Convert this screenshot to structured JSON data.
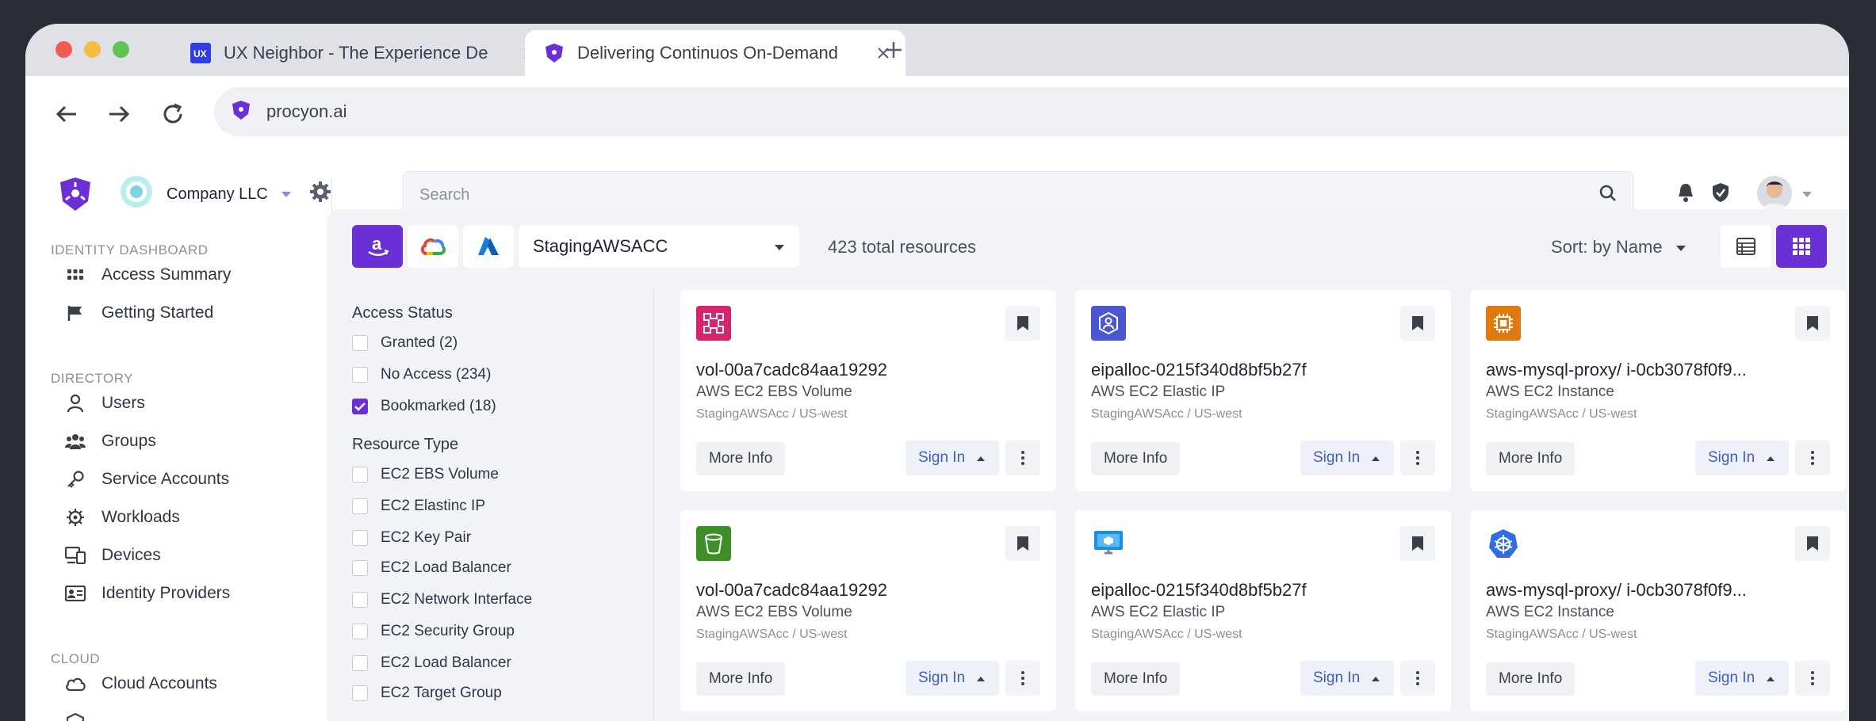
{
  "browser": {
    "tabs": [
      {
        "title": "UX Neighbor - The Experience De",
        "active": false
      },
      {
        "title": "Delivering Continuos On-Demand",
        "active": true
      }
    ],
    "url": "procyon.ai"
  },
  "header": {
    "company": "Company LLC",
    "search_placeholder": "Search"
  },
  "sidebar": {
    "sections": [
      {
        "title": "IDENTITY DASHBOARD",
        "items": [
          {
            "label": "Access Summary",
            "icon": "grid-dots-icon"
          },
          {
            "label": "Getting Started",
            "icon": "flag-icon"
          }
        ]
      },
      {
        "title": "DIRECTORY",
        "items": [
          {
            "label": "Users",
            "icon": "user-icon"
          },
          {
            "label": "Groups",
            "icon": "users-icon"
          },
          {
            "label": "Service Accounts",
            "icon": "key-icon"
          },
          {
            "label": "Workloads",
            "icon": "cog-icon"
          },
          {
            "label": "Devices",
            "icon": "devices-icon"
          },
          {
            "label": "Identity Providers",
            "icon": "id-card-icon"
          }
        ]
      },
      {
        "title": "CLOUD",
        "items": [
          {
            "label": "Cloud Accounts",
            "icon": "cloud-icon"
          }
        ]
      }
    ]
  },
  "toolbar": {
    "account": "StagingAWSACC",
    "total": "423 total resources",
    "sort": "Sort: by Name"
  },
  "filters": {
    "access_title": "Access Status",
    "access": [
      {
        "label": "Granted (2)",
        "checked": false
      },
      {
        "label": "No Access (234)",
        "checked": false
      },
      {
        "label": "Bookmarked (18)",
        "checked": true
      }
    ],
    "type_title": "Resource Type",
    "types": [
      {
        "label": "EC2 EBS Volume"
      },
      {
        "label": "EC2 Elastinc IP"
      },
      {
        "label": "EC2 Key Pair"
      },
      {
        "label": "EC2 Load Balancer"
      },
      {
        "label": "EC2 Network Interface"
      },
      {
        "label": "EC2 Security Group"
      },
      {
        "label": "EC2 Load Balancer"
      },
      {
        "label": "EC2 Target Group"
      }
    ]
  },
  "card_labels": {
    "more": "More Info",
    "signin": "Sign In"
  },
  "cards": [
    {
      "name": "vol-00a7cadc84aa19292",
      "type": "AWS EC2 EBS Volume",
      "account": "StagingAWSAcc / US-west",
      "icon": "ebs-volume-icon",
      "color": "#d6246e"
    },
    {
      "name": "eipalloc-0215f340d8bf5b27f",
      "type": "AWS EC2 Elastic IP",
      "account": "StagingAWSAcc / US-west",
      "icon": "elastic-ip-icon",
      "color": "#4b56d2"
    },
    {
      "name": "aws-mysql-proxy/ i-0cb3078f0f9...",
      "type": "AWS EC2 Instance",
      "account": "StagingAWSAcc / US-west",
      "icon": "ec2-instance-icon",
      "color": "#e07a10"
    },
    {
      "name": "vol-00a7cadc84aa19292",
      "type": "AWS EC2 EBS Volume",
      "account": "StagingAWSAcc / US-west",
      "icon": "s3-bucket-icon",
      "color": "#3f8f29"
    },
    {
      "name": "eipalloc-0215f340d8bf5b27f",
      "type": "AWS EC2 Elastic IP",
      "account": "StagingAWSAcc / US-west",
      "icon": "monitor-icon",
      "color": "#1d8fe0"
    },
    {
      "name": "aws-mysql-proxy/ i-0cb3078f0f9...",
      "type": "AWS EC2 Instance",
      "account": "StagingAWSAcc / US-west",
      "icon": "kubernetes-icon",
      "color": "#326ce5"
    }
  ],
  "colors": {
    "accent": "#6b2fd6",
    "link": "#3f5fb8"
  }
}
